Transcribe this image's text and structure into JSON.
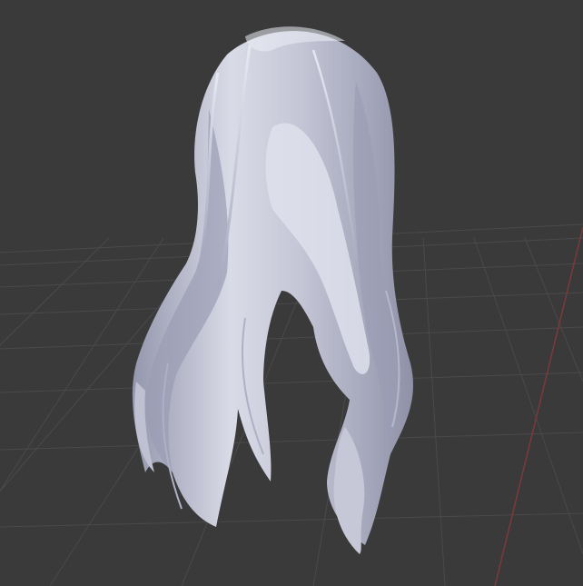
{
  "viewport": {
    "background_color": "#3a3a3a",
    "grid_line_color": "#4a4a4a",
    "x_axis_color": "#7a3a3a"
  },
  "model": {
    "object": "hair-mesh",
    "shade_color": "#c8cad8",
    "highlight_color": "#e4e6f0",
    "shadow_color": "#8e90a6"
  }
}
